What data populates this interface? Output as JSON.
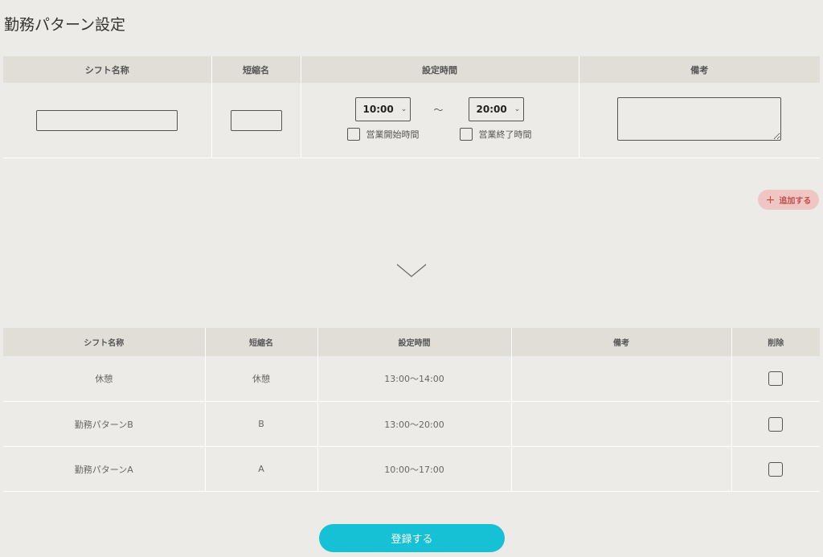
{
  "page": {
    "title": "勤務パターン設定"
  },
  "form": {
    "headers": {
      "name": "シフト名称",
      "short": "短縮名",
      "time": "設定時間",
      "memo": "備考"
    },
    "name_value": "",
    "short_value": "",
    "start_time": "10:00",
    "end_time": "20:00",
    "tilde": "～",
    "open_label": "営業開始時間",
    "close_label": "営業終了時間",
    "memo_value": ""
  },
  "add_button": {
    "icon": "plus-icon",
    "label": "追加する"
  },
  "list": {
    "headers": {
      "name": "シフト名称",
      "short": "短縮名",
      "time": "設定時間",
      "memo": "備考",
      "delete": "削除"
    },
    "rows": [
      {
        "name": "休憩",
        "short": "休憩",
        "time": "13:00～14:00",
        "memo": ""
      },
      {
        "name": "勤務パターンB",
        "short": "B",
        "time": "13:00～20:00",
        "memo": ""
      },
      {
        "name": "勤務パターンA",
        "short": "A",
        "time": "10:00～17:00",
        "memo": ""
      }
    ]
  },
  "submit": {
    "label": "登録する"
  },
  "colors": {
    "accent": "#16c1d6",
    "add_bg": "#f0c6c4",
    "add_text": "#c0504c",
    "header_bg": "#e1ded7",
    "page_bg": "#ecebe7"
  }
}
